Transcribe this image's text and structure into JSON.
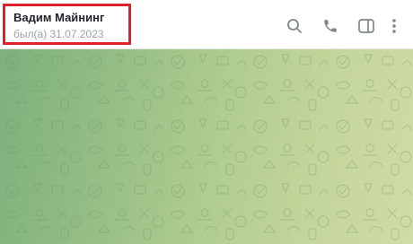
{
  "chat_header": {
    "title": "Вадим Майнинг",
    "status": "был(а) 31.07.2023"
  },
  "toolbar": {
    "icons": [
      "search-icon",
      "phone-icon",
      "sidebar-toggle-icon",
      "more-vertical-icon"
    ]
  },
  "colors": {
    "highlight_border": "#e0202a",
    "icon": "#7d868d",
    "title": "#1f2328",
    "status": "#9aa3ab",
    "background_start": "#7eb07c",
    "background_end": "#d0dca4"
  }
}
